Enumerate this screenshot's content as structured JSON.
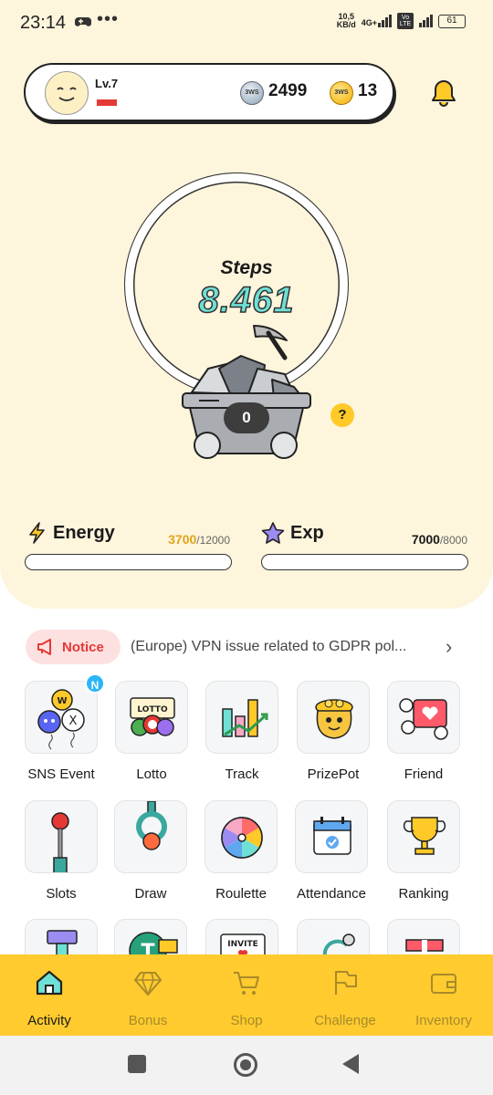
{
  "status_bar": {
    "time": "23:14",
    "more": "•••",
    "speed_top": "10,5",
    "speed_bottom": "KB/d",
    "network": "4G+",
    "volte": "Vo LTE",
    "battery": "61"
  },
  "profile": {
    "level": "Lv.7",
    "silver_coin_icon_text": "3WS",
    "silver_coins": "2499",
    "gold_coin_icon_text": "3WS",
    "gold_coins": "13"
  },
  "steps": {
    "label": "Steps",
    "value": "8.461",
    "cart_count": "0",
    "help": "?"
  },
  "energy": {
    "label": "Energy",
    "current": "3700",
    "max": "/12000",
    "fill": 0.0
  },
  "exp": {
    "label": "Exp",
    "current": "7000",
    "max": "/8000",
    "fill": 0.0
  },
  "notice": {
    "label": "Notice",
    "text": "(Europe) VPN issue related to GDPR pol..."
  },
  "grid": {
    "sns_badge": "N",
    "items": [
      {
        "label": "SNS Event"
      },
      {
        "label": "Lotto"
      },
      {
        "label": "Track"
      },
      {
        "label": "PrizePot"
      },
      {
        "label": "Friend"
      },
      {
        "label": "Slots"
      },
      {
        "label": "Draw"
      },
      {
        "label": "Roulette"
      },
      {
        "label": "Attendance"
      },
      {
        "label": "Ranking"
      }
    ],
    "lotto_tile_text": "LOTTO",
    "invite_tile_text": "INVITE"
  },
  "bottom_nav": {
    "items": [
      {
        "label": "Activity"
      },
      {
        "label": "Bonus"
      },
      {
        "label": "Shop"
      },
      {
        "label": "Challenge"
      },
      {
        "label": "Inventory"
      }
    ],
    "active": "Activity"
  },
  "colors": {
    "accent_yellow": "#ffcb2e",
    "hero_bg": "#fdf5dc",
    "steps_teal": "#6fe0d5",
    "energy_gold": "#e0a41b",
    "notice_red": "#e53935"
  }
}
